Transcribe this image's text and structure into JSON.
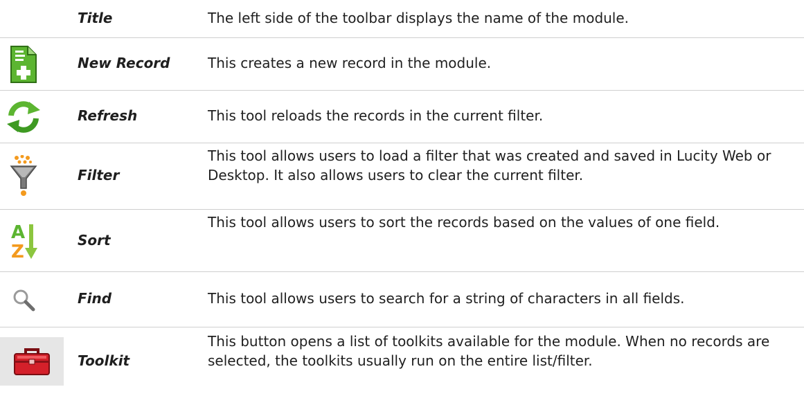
{
  "rows": [
    {
      "name": "Title",
      "description": "The left side of the toolbar displays the name of the module.",
      "icon": "none"
    },
    {
      "name": "New Record",
      "description": "This creates a new record in the module.",
      "icon": "new-record-icon"
    },
    {
      "name": "Refresh",
      "description": "This tool reloads the records in the current filter.",
      "icon": "refresh-icon"
    },
    {
      "name": "Filter",
      "description": "This tool allows users to load a filter that was created and saved in Lucity Web or Desktop. It also allows users to clear the current filter.",
      "icon": "filter-icon"
    },
    {
      "name": "Sort",
      "description": "This tool allows users to sort the records based on the values of one field.",
      "icon": "sort-icon"
    },
    {
      "name": "Find",
      "description": "This tool allows users to search for a string of characters in all fields.",
      "icon": "find-icon"
    },
    {
      "name": "Toolkit",
      "description": "This button opens a list of toolkits available for the module. When no records are selected, the toolkits usually run on the entire list/filter.",
      "icon": "toolkit-icon"
    }
  ],
  "colors": {
    "green": "#5cb531",
    "orange": "#f39a1e",
    "red": "#d4202a",
    "gray": "#8a8a8a",
    "divider": "#cfcfcf"
  }
}
